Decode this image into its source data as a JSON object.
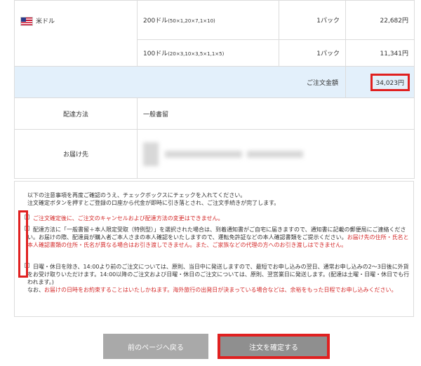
{
  "order": {
    "currency_label": "米ドル",
    "rows": [
      {
        "denomination": "200ドル",
        "breakdown": "(50×1,20×7,1×10)",
        "qty": "1パック",
        "price": "22,682円"
      },
      {
        "denomination": "100ドル",
        "breakdown": "(20×3,10×3,5×1,1×5)",
        "qty": "1パック",
        "price": "11,341円"
      }
    ],
    "total_label": "ご注文金額",
    "total_value": "34,023円",
    "delivery_method_label": "配達方法",
    "delivery_method_value": "一般書留",
    "destination_label": "お届け先"
  },
  "notes": {
    "intro_line1": "以下の注意事項を再度ご確認のうえ、チェックボックスにチェックを入れてください。",
    "intro_line2": "注文確定ボタンを押すとご登録の口座から代金が即時に引き落とされ、ご注文手続きが完了します。",
    "item1": "ご注文確定後に、ご注文のキャンセルおよび配達方法の変更はできません。",
    "item2_a": "配達方法に「一般書留＋本人限定受取（特例型）」を選択された場合は、到着通知書がご自宅に届きますので、通知書に記載の郵便局にご連絡ください。お届けの際、配達員が購入者ご本人さまの本人確認をいたしますので、運転免許証などの本人確認書類をご提示ください。",
    "item2_b": "お届け先の住所・氏名と本人確認書類の住所・氏名が異なる場合はお引き渡しできません。また、ご家族などの代理の方へのお引き渡しはできません。",
    "item3_a": "日曜・休日を除き、14:00より前のご注文については、原則、当日中に発送しますので、最短でお申し込みの翌日、通常お申し込みの2〜3日後に外貨をお受け取りいただけます。14:00以降のご注文および日曜・休日のご注文については、原則、翌営業日に発送します。(配達は土曜・日曜・休日でも行われます。)",
    "item3_b": "なお、",
    "item3_c": "お届けの日時をお約束することはいたしかねます。海外旅行の出発日が決まっている場合などは、余裕をもった日程でお申し込みください。"
  },
  "buttons": {
    "back_label": "前のページへ戻る",
    "confirm_label": "注文を確定する"
  },
  "colors": {
    "highlight_red": "#e02020",
    "total_row_bg": "#e3f0fb",
    "notice_red": "#d42a2a",
    "button_gray": "#a9a9a9"
  }
}
